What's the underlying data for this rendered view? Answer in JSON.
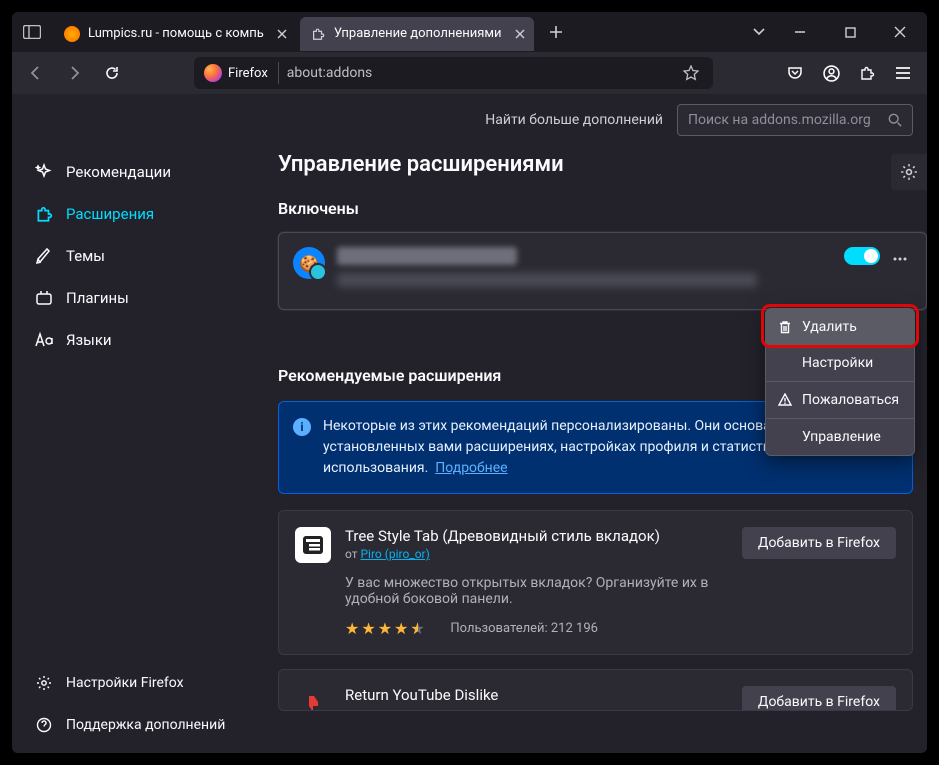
{
  "titlebar": {
    "tabs": [
      {
        "label": "Lumpics.ru - помощь с компь"
      },
      {
        "label": "Управление дополнениями"
      }
    ]
  },
  "urlbar": {
    "brand": "Firefox",
    "address": "about:addons"
  },
  "findbar": {
    "label": "Найти больше дополнений",
    "placeholder": "Поиск на addons.mozilla.org"
  },
  "sidebar": {
    "items": [
      {
        "label": "Рекомендации"
      },
      {
        "label": "Расширения"
      },
      {
        "label": "Темы"
      },
      {
        "label": "Плагины"
      },
      {
        "label": "Языки"
      }
    ],
    "footer": [
      {
        "label": "Настройки Firefox"
      },
      {
        "label": "Поддержка дополнений"
      }
    ]
  },
  "main": {
    "heading": "Управление расширениями",
    "enabled_title": "Включены",
    "recommended_title": "Рекомендуемые расширения"
  },
  "popup": {
    "delete": "Удалить",
    "settings": "Настройки",
    "report": "Пожаловаться",
    "manage": "Управление"
  },
  "info": {
    "text_a": "Некоторые из этих рекомендаций персонализированы. Они основаны на других установленных вами расширениях, настройках профиля и статистике использования.",
    "learn_more": "Подробнее"
  },
  "rec1": {
    "title": "Tree Style Tab (Древовидный стиль вкладок)",
    "by_prefix": "от ",
    "author": "Piro (piro_or)",
    "desc": "У вас множество открытых вкладок? Организуйте их в удобной боковой панели.",
    "users_label": "Пользователей: 212 196",
    "add": "Добавить в Firefox"
  },
  "rec2": {
    "title": "Return YouTube Dislike",
    "add": "Добавить в Firefox"
  }
}
